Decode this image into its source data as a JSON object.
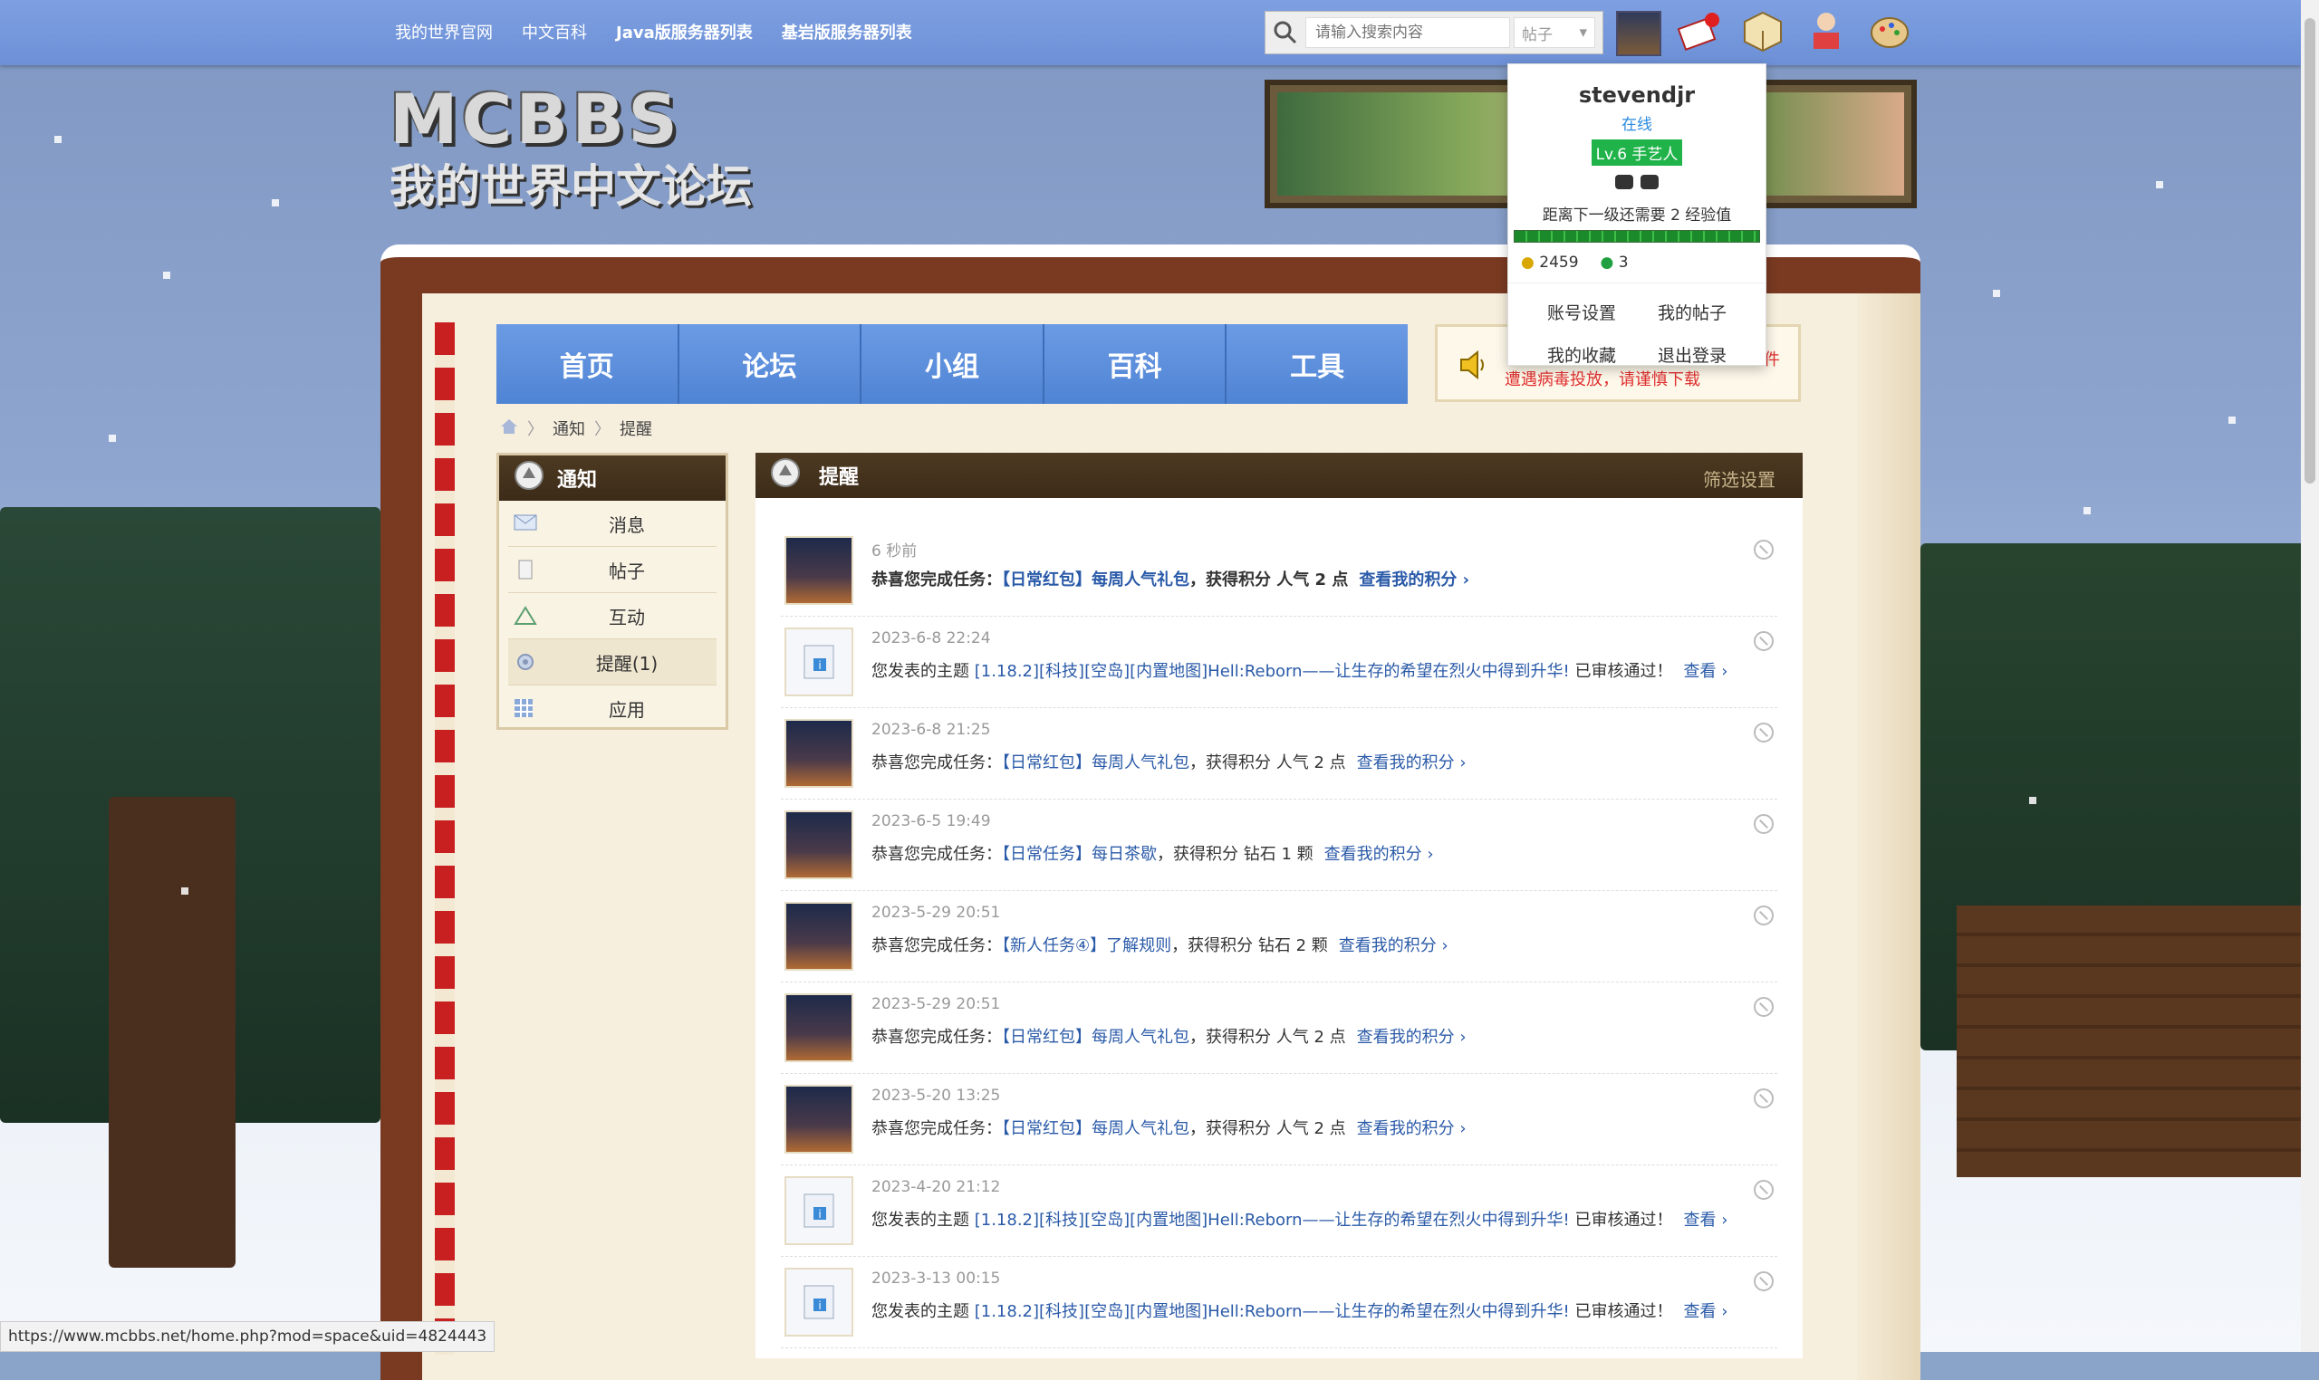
{
  "toplinks": {
    "official": "我的世界官网",
    "wiki": "中文百科",
    "java_servers": "Java版服务器列表",
    "bedrock_servers": "基岩版服务器列表"
  },
  "search": {
    "placeholder": "请输入搜索内容",
    "type": "帖子"
  },
  "logo": {
    "line1": "MCBBS",
    "line2": "我的世界中文论坛"
  },
  "nav": {
    "home": "首页",
    "forum": "论坛",
    "group": "小组",
    "wiki": "百科",
    "tools": "工具"
  },
  "notice": {
    "line2": "遭遇病毒投放，请谨慎下载",
    "tail": "件"
  },
  "breadcrumb": {
    "item1": "通知",
    "item2": "提醒"
  },
  "sidebar": {
    "title": "通知",
    "items": [
      "消息",
      "帖子",
      "互动",
      "提醒(1)",
      "应用"
    ]
  },
  "panel": {
    "title": "提醒",
    "filter": "筛选设置"
  },
  "items": [
    {
      "time": "6 秒前",
      "prefix": "恭喜您完成任务：",
      "link": "【日常红包】每周人气礼包",
      "suffix": "，获得积分 人气 2 点",
      "more": "查看我的积分 ›"
    },
    {
      "time": "2023-6-8 22:24",
      "prefix": "您发表的主题 ",
      "link": "[1.18.2][科技][空岛][内置地图]Hell:Reborn——让生存的希望在烈火中得到升华!",
      "suffix": " 已审核通过！",
      "more": "查看 ›"
    },
    {
      "time": "2023-6-8 21:25",
      "prefix": "恭喜您完成任务：",
      "link": "【日常红包】每周人气礼包",
      "suffix": "，获得积分 人气 2 点",
      "more": "查看我的积分 ›"
    },
    {
      "time": "2023-6-5 19:49",
      "prefix": "恭喜您完成任务：",
      "link": "【日常任务】每日茶歇",
      "suffix": "，获得积分 钻石 1 颗",
      "more": "查看我的积分 ›"
    },
    {
      "time": "2023-5-29 20:51",
      "prefix": "恭喜您完成任务：",
      "link": "【新人任务④】了解规则",
      "suffix": "，获得积分 钻石 2 颗",
      "more": "查看我的积分 ›"
    },
    {
      "time": "2023-5-29 20:51",
      "prefix": "恭喜您完成任务：",
      "link": "【日常红包】每周人气礼包",
      "suffix": "，获得积分 人气 2 点",
      "more": "查看我的积分 ›"
    },
    {
      "time": "2023-5-20 13:25",
      "prefix": "恭喜您完成任务：",
      "link": "【日常红包】每周人气礼包",
      "suffix": "，获得积分 人气 2 点",
      "more": "查看我的积分 ›"
    },
    {
      "time": "2023-4-20 21:12",
      "prefix": "您发表的主题 ",
      "link": "[1.18.2][科技][空岛][内置地图]Hell:Reborn——让生存的希望在烈火中得到升华!",
      "suffix": " 已审核通过！",
      "more": "查看 ›"
    },
    {
      "time": "2023-3-13 00:15",
      "prefix": "您发表的主题 ",
      "link": "[1.18.2][科技][空岛][内置地图]Hell:Reborn——让生存的希望在烈火中得到升华!",
      "suffix": " 已审核通过！",
      "more": "查看 ›"
    }
  ],
  "dropdown": {
    "username": "stevendjr",
    "status": "在线",
    "level": "Lv.6 手艺人",
    "exp_text": "距离下一级还需要 2 经验值",
    "gold": "2459",
    "emerald": "3",
    "menu": [
      "账号设置",
      "我的帖子",
      "我的收藏",
      "退出登录"
    ]
  },
  "status_url": "https://www.mcbbs.net/home.php?mod=space&uid=4824443"
}
